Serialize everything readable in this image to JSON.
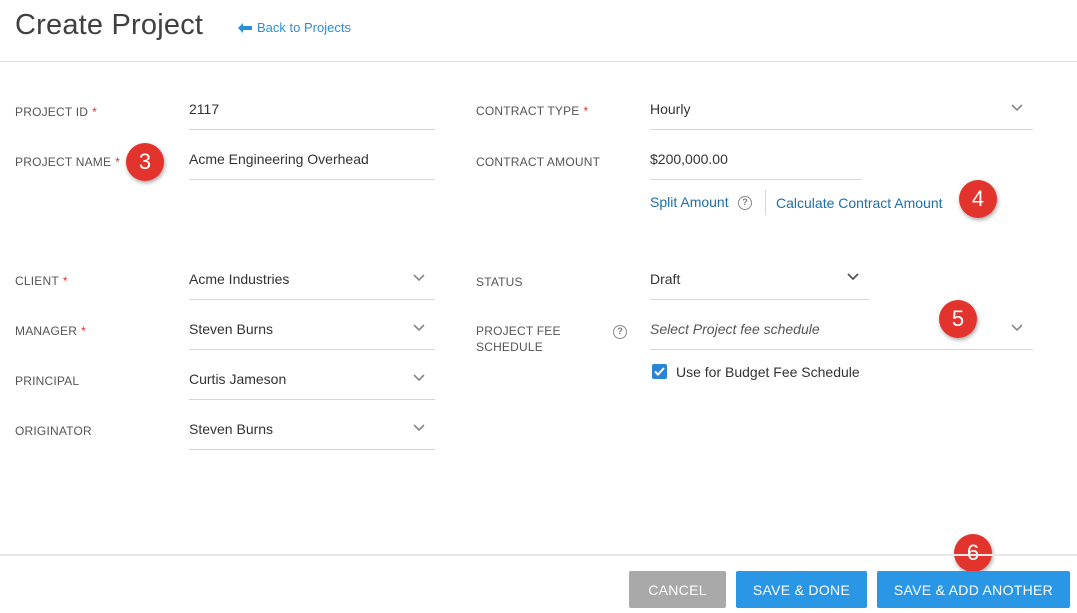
{
  "header": {
    "title": "Create Project",
    "back_link": "Back to Projects"
  },
  "form": {
    "project_id": {
      "label": "PROJECT ID",
      "required": "*",
      "value": "2117"
    },
    "project_name": {
      "label": "PROJECT NAME",
      "required": "*",
      "value": "Acme Engineering Overhead"
    },
    "contract_type": {
      "label": "CONTRACT TYPE",
      "required": "*",
      "value": "Hourly"
    },
    "contract_amount": {
      "label": "CONTRACT AMOUNT",
      "value": "$200,000.00"
    },
    "split_amount": "Split Amount",
    "calculate_amount": "Calculate Contract Amount",
    "client": {
      "label": "CLIENT",
      "required": "*",
      "value": "Acme Industries"
    },
    "manager": {
      "label": "MANAGER",
      "required": "*",
      "value": "Steven Burns"
    },
    "principal": {
      "label": "PRINCIPAL",
      "value": "Curtis Jameson"
    },
    "originator": {
      "label": "ORIGINATOR",
      "value": "Steven Burns"
    },
    "status": {
      "label": "STATUS",
      "value": "Draft"
    },
    "fee_schedule": {
      "label_line1": "PROJECT FEE",
      "label_line2": "SCHEDULE",
      "placeholder": "Select Project fee schedule"
    },
    "budget_checkbox": {
      "label": "Use for Budget Fee Schedule",
      "checked": true
    }
  },
  "help_glyph": "?",
  "badges": [
    "3",
    "4",
    "5",
    "6"
  ],
  "footer": {
    "cancel": "CANCEL",
    "save_done": "SAVE & DONE",
    "save_another": "SAVE & ADD ANOTHER"
  },
  "colors": {
    "accent": "#2996e6",
    "link": "#1f6fa8",
    "required": "#e03030",
    "badge": "#e2342d",
    "cancel": "#a9a9a9"
  }
}
